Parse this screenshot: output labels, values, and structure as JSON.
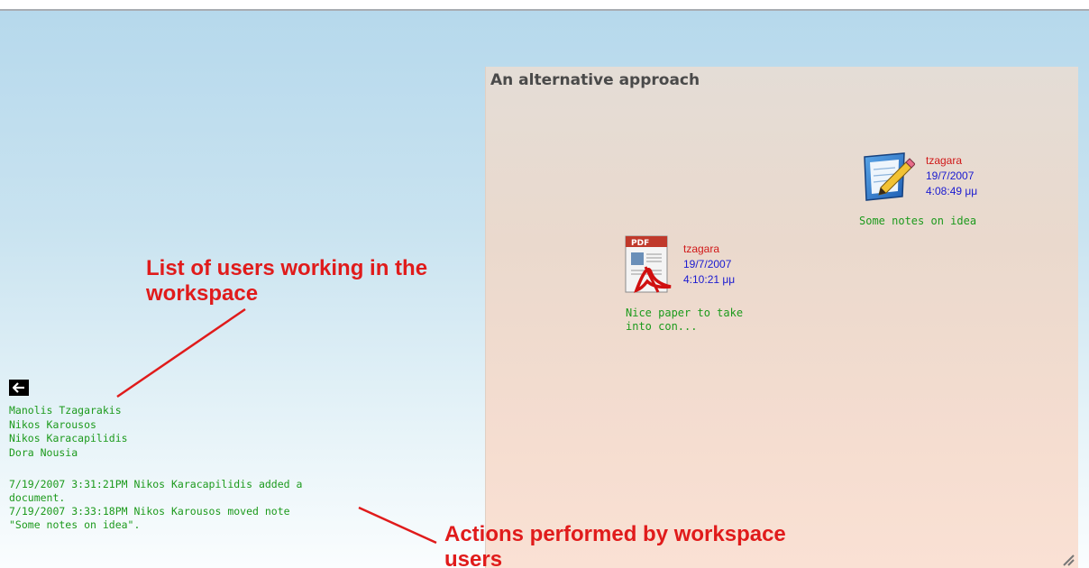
{
  "workspace": {
    "title": "An alternative approach",
    "items": [
      {
        "type": "note",
        "icon": "note-pencil-icon",
        "author": "tzagara",
        "date": "19/7/2007",
        "time": "4:08:49 μμ",
        "caption": "Some notes on idea"
      },
      {
        "type": "document",
        "icon": "pdf-document-icon",
        "author": "tzagara",
        "date": "19/7/2007",
        "time": "4:10:21 μμ",
        "caption_line1": "Nice paper to take",
        "caption_line2": "into con..."
      }
    ]
  },
  "users": [
    "Manolis Tzagarakis",
    "Nikos Karousos",
    "Nikos Karacapilidis",
    "Dora Nousia"
  ],
  "activity_log": [
    "7/19/2007 3:31:21PM Nikos Karacapilidis added a",
    "document.",
    "7/19/2007 3:33:18PM Nikos Karousos moved note",
    "\"Some notes on idea\"."
  ],
  "annotations": {
    "users_line1": "List of users working in the",
    "users_line2": "workspace",
    "actions_line1": "Actions performed by workspace",
    "actions_line2": "users"
  },
  "colors": {
    "annotation": "#e01b1b",
    "green_text": "#1c9a1c",
    "author": "#d01818",
    "timestamp": "#1a1ad0"
  }
}
